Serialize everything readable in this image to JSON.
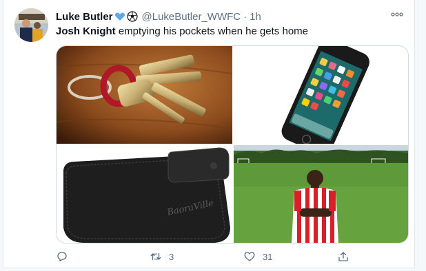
{
  "tweet": {
    "display_name": "Luke Butler",
    "name_emojis": [
      "blue-heart-icon",
      "soccer-ball-icon"
    ],
    "handle": "@LukeButler_WWFC",
    "separator": "·",
    "time": "1h",
    "text_bold": "Josh Knight",
    "text_rest": " emptying his pockets when he gets home",
    "media": [
      {
        "name": "keys-photo",
        "icon": "keys-image"
      },
      {
        "name": "iphone-photo",
        "icon": "phone-image"
      },
      {
        "name": "wallet-photo",
        "icon": "wallet-image",
        "brand_text": "BaoraVille"
      },
      {
        "name": "player-photo",
        "icon": "footballer-image"
      }
    ],
    "actions": {
      "reply_count": "",
      "retweet_count": "3",
      "like_count": "31"
    }
  },
  "colors": {
    "secondary_text": "#5b7083",
    "border": "#cfd9de",
    "heart": "#5da9e9"
  }
}
